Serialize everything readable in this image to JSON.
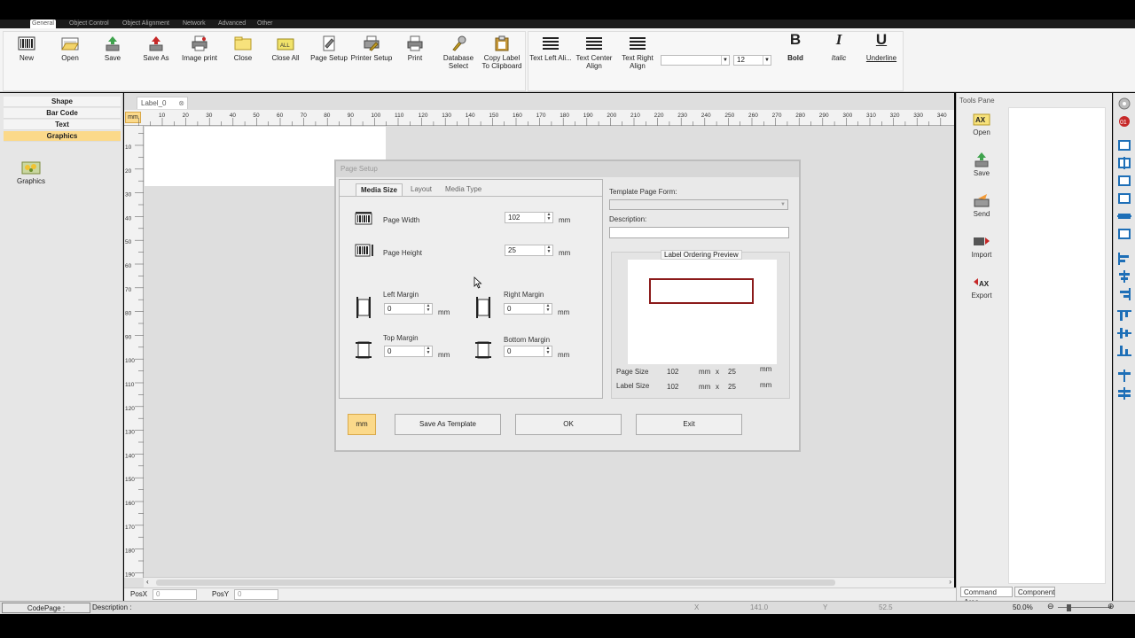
{
  "menu": {
    "tabs": [
      "General",
      "Object Control",
      "Object Alignment",
      "Network",
      "Advanced",
      "Other"
    ]
  },
  "ribbon": {
    "buttons": [
      {
        "label": "New",
        "icon": "barcode-icon"
      },
      {
        "label": "Open",
        "icon": "open-folder-icon"
      },
      {
        "label": "Save",
        "icon": "save-icon"
      },
      {
        "label": "Save As",
        "icon": "save-as-icon"
      },
      {
        "label": "Image print",
        "icon": "image-print-icon"
      },
      {
        "label": "Close",
        "icon": "close-folder-icon"
      },
      {
        "label": "Close All",
        "icon": "close-all-icon"
      },
      {
        "label": "Page Setup",
        "icon": "page-setup-icon"
      },
      {
        "label": "Printer Setup",
        "icon": "printer-setup-icon"
      },
      {
        "label": "Print",
        "icon": "printer-icon"
      },
      {
        "label": "Database Select",
        "icon": "database-icon"
      },
      {
        "label": "Copy Label To Clipboard",
        "icon": "clipboard-icon"
      }
    ],
    "align_buttons": [
      {
        "label": "Text Left Ali...",
        "icon": "align-left-icon"
      },
      {
        "label": "Text Center Align",
        "icon": "align-center-icon"
      },
      {
        "label": "Text Right Align",
        "icon": "align-right-icon"
      }
    ],
    "font_name": "",
    "font_size": "12",
    "bold_label": "Bold",
    "italic_label": "Italic",
    "underline_label": "Underline",
    "bold_glyph": "B",
    "italic_glyph": "I",
    "underline_glyph": "U"
  },
  "left_panel": {
    "items": [
      "Shape",
      "Bar Code",
      "Text",
      "Graphics"
    ],
    "active": "Graphics",
    "tool_label": "Graphics"
  },
  "document": {
    "tab_label": "Label_0",
    "ruler_unit": "mm",
    "ruler_h_ticks": [
      "10",
      "20",
      "30",
      "40",
      "50",
      "60",
      "70",
      "80",
      "90",
      "100",
      "110",
      "120",
      "130",
      "140",
      "150",
      "160",
      "170",
      "180",
      "190",
      "200",
      "210",
      "220",
      "230",
      "240",
      "250",
      "260",
      "270",
      "280",
      "290",
      "300",
      "310",
      "320",
      "330",
      "340"
    ],
    "ruler_v_ticks": [
      "10",
      "20",
      "30",
      "40",
      "50",
      "60",
      "70",
      "80",
      "90",
      "100",
      "110",
      "120",
      "130",
      "140",
      "150",
      "160",
      "170",
      "180",
      "190"
    ]
  },
  "pos_bar": {
    "posx_label": "PosX",
    "posx_value": "0",
    "posy_label": "PosY",
    "posy_value": "0"
  },
  "status_bar": {
    "codepage_label": "CodePage :",
    "description_label": "Description :",
    "x_label": "X",
    "x_value": "141.0",
    "y_label": "Y",
    "y_value": "52.5",
    "zoom": "50.0%"
  },
  "tools_pane": {
    "title": "Tools Pane",
    "buttons": [
      "Open",
      "Save",
      "Send",
      "Import",
      "Export"
    ],
    "tabs": [
      "Command Area",
      "Component"
    ]
  },
  "dialog": {
    "title": "Page Setup",
    "tabs": [
      "Media Size",
      "Layout",
      "Media Type"
    ],
    "page_width_label": "Page Width",
    "page_width": "102",
    "page_height_label": "Page Height",
    "page_height": "25",
    "left_margin_label": "Left Margin",
    "left_margin": "0",
    "right_margin_label": "Right Margin",
    "right_margin": "0",
    "top_margin_label": "Top Margin",
    "top_margin": "0",
    "bottom_margin_label": "Bottom Margin",
    "bottom_margin": "0",
    "unit": "mm",
    "template_form_label": "Template Page Form:",
    "description_label": "Description:",
    "preview_title": "Label Ordering Preview",
    "page_size_label": "Page Size",
    "page_size_w": "102",
    "page_size_h": "25",
    "label_size_label": "Label Size",
    "label_size_w": "102",
    "label_size_h": "25",
    "times": "x",
    "buttons": {
      "unit": "mm",
      "save_template": "Save As Template",
      "ok": "OK",
      "exit": "Exit"
    }
  }
}
